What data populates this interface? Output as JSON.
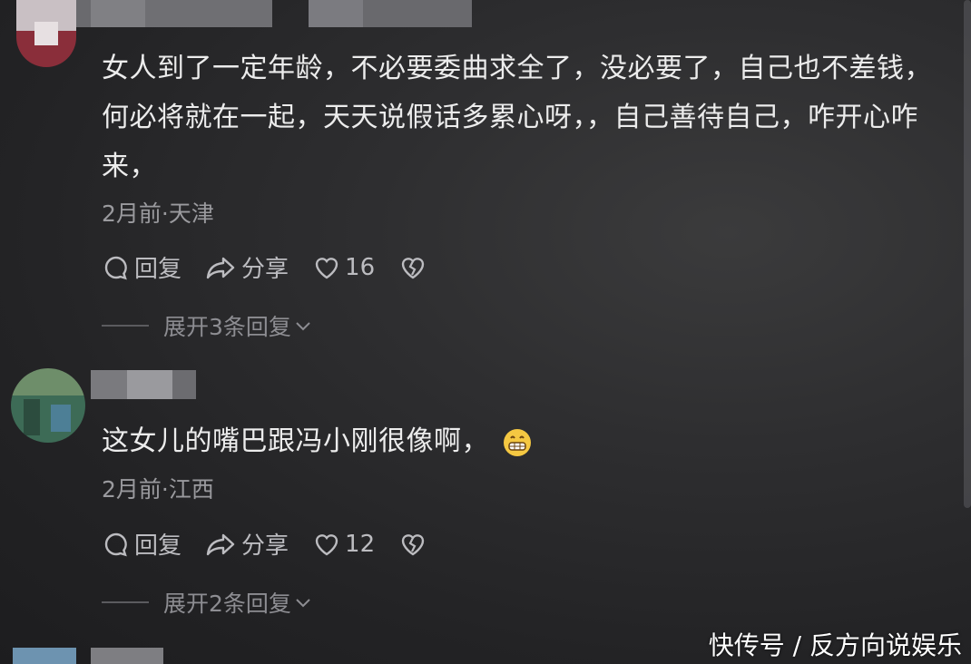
{
  "comments": [
    {
      "text": "女人到了一定年龄，不必要委曲求全了，没必要了，自己也不差钱，何必将就在一起，天天说假话多累心呀，，自己善待自己，咋开心咋来，",
      "meta": "2月前·天津",
      "reply_label": "回复",
      "share_label": "分享",
      "likes": "16",
      "expand_label": "展开3条回复"
    },
    {
      "text": "这女儿的嘴巴跟冯小刚很像啊，",
      "emoji": "grinning-teeth-emoji",
      "meta": "2月前·江西",
      "reply_label": "回复",
      "share_label": "分享",
      "likes": "12",
      "expand_label": "展开2条回复"
    }
  ],
  "watermark": "快传号 / 反方向说娱乐",
  "colors": {
    "background": "#2b2b2d",
    "text": "#ececec",
    "meta": "#9a9a9e",
    "action": "#bcbcc0"
  }
}
